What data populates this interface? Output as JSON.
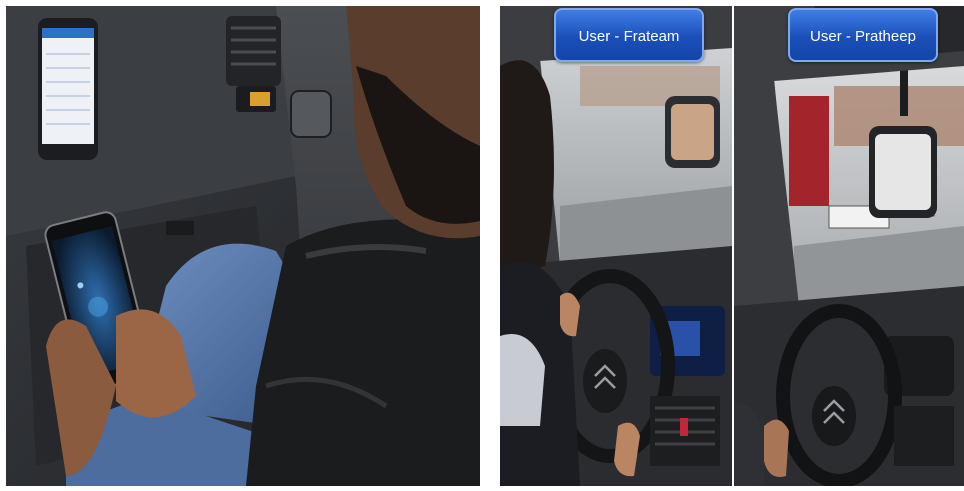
{
  "panels": {
    "left": {
      "description_free": true
    },
    "middle": {
      "user_label": "User - Frateam"
    },
    "right": {
      "user_label": "User - Pratheep"
    }
  },
  "colors": {
    "label_blue": "#1b4fb8",
    "label_border": "#7ea9f0",
    "car_interior_dark": "#2a2c30",
    "jeans_blue": "#4a6fa5",
    "dashboard_display": "#1e3a8a"
  }
}
